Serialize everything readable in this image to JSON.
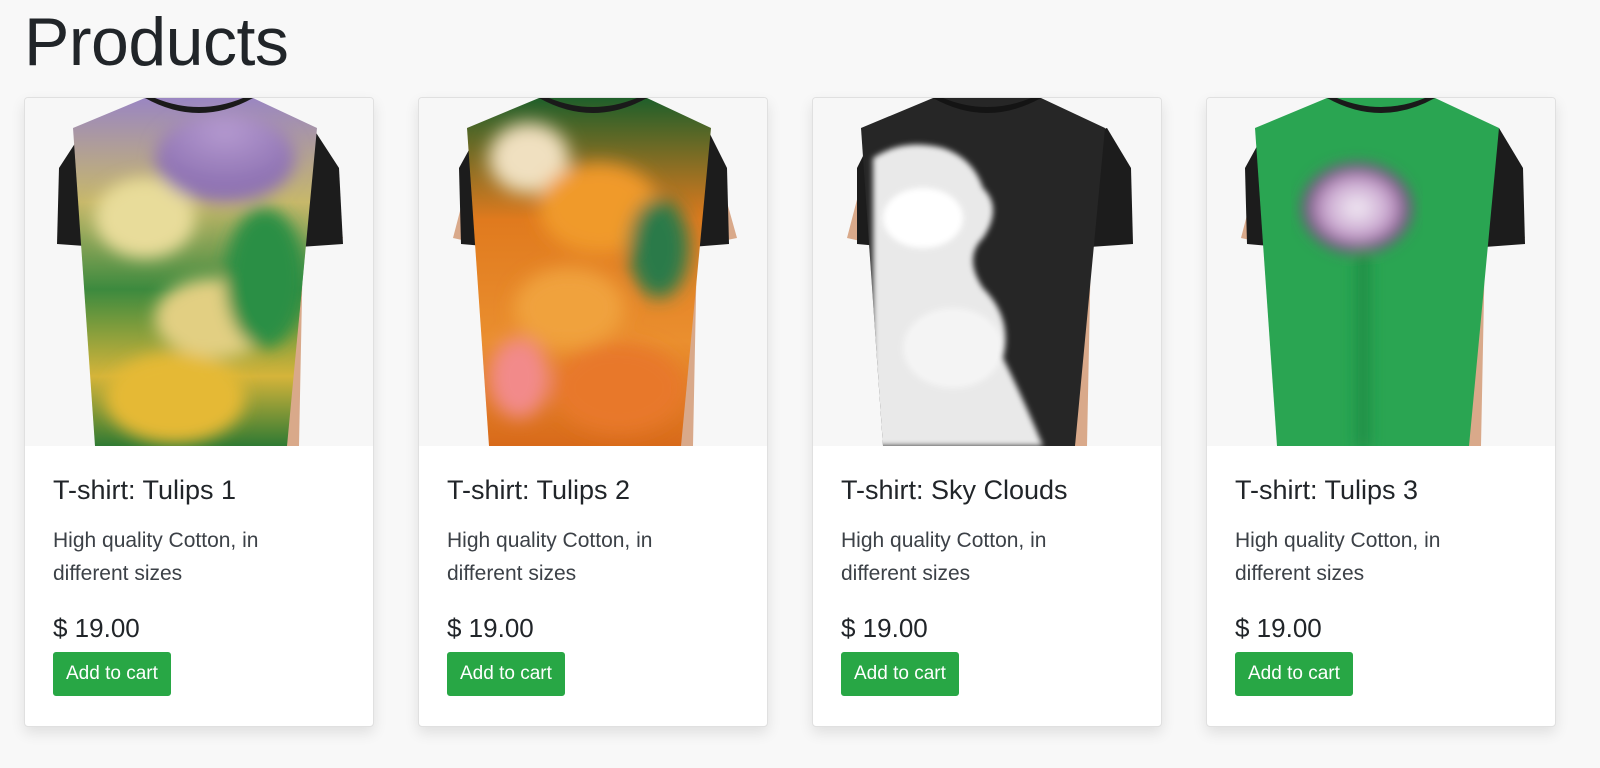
{
  "page": {
    "title": "Products"
  },
  "products": [
    {
      "title": "T-shirt: Tulips 1",
      "description": "High quality Cotton, in different sizes",
      "price": "$ 19.00",
      "button_label": "Add to cart",
      "image_icon": "tshirt-tulips-1-image"
    },
    {
      "title": "T-shirt: Tulips 2",
      "description": "High quality Cotton, in different sizes",
      "price": "$ 19.00",
      "button_label": "Add to cart",
      "image_icon": "tshirt-tulips-2-image"
    },
    {
      "title": "T-shirt: Sky Clouds",
      "description": "High quality Cotton, in different sizes",
      "price": "$ 19.00",
      "button_label": "Add to cart",
      "image_icon": "tshirt-sky-clouds-image"
    },
    {
      "title": "T-shirt: Tulips 3",
      "description": "High quality Cotton, in different sizes",
      "price": "$ 19.00",
      "button_label": "Add to cart",
      "image_icon": "tshirt-tulips-3-image"
    }
  ],
  "colors": {
    "button": "#28a745",
    "page_background": "#f8f8f8",
    "card_background": "#ffffff"
  }
}
